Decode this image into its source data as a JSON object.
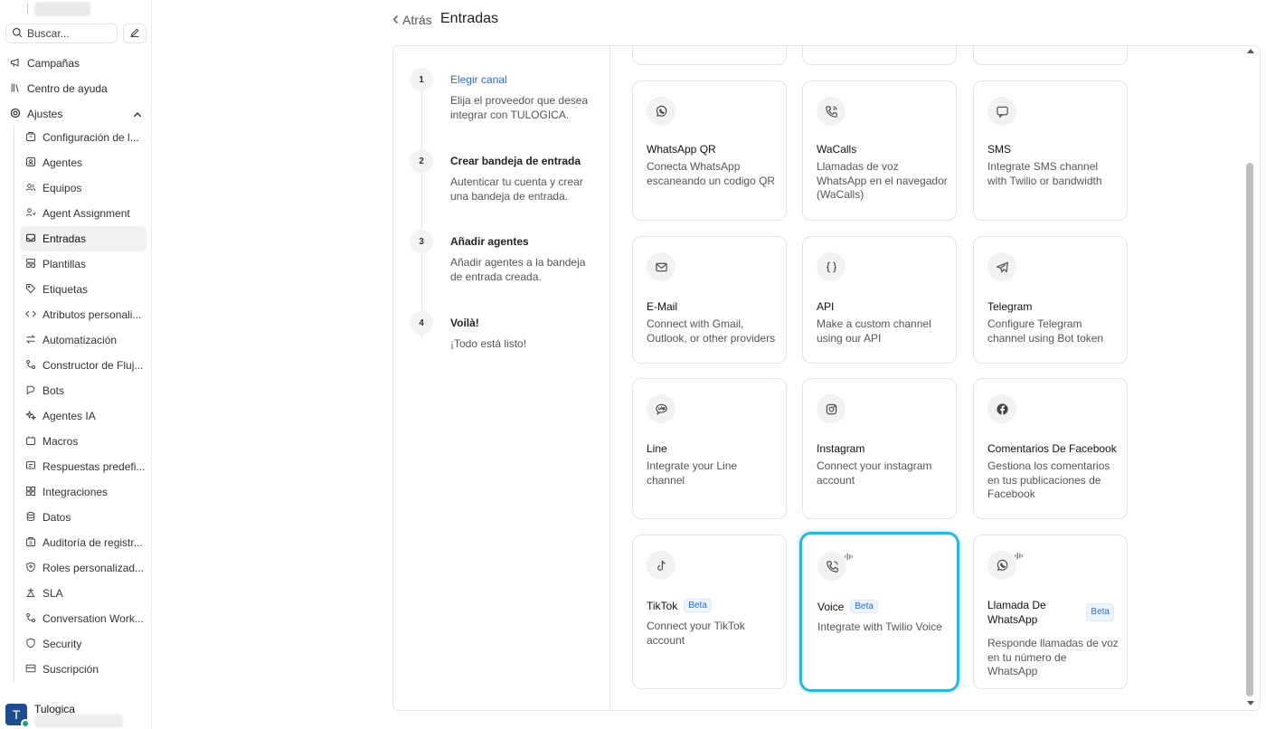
{
  "sidebar": {
    "search_placeholder": "Buscar...",
    "top_items": [
      {
        "label": "Campañas",
        "icon": "megaphone-icon"
      },
      {
        "label": "Centro de ayuda",
        "icon": "library-icon"
      },
      {
        "label": "Ajustes",
        "icon": "settings-icon"
      }
    ],
    "sub_items": [
      {
        "label": "Configuración de l...",
        "icon": "building-icon"
      },
      {
        "label": "Agentes",
        "icon": "agent-icon"
      },
      {
        "label": "Equipos",
        "icon": "team-icon"
      },
      {
        "label": "Agent Assignment",
        "icon": "assignment-icon"
      },
      {
        "label": "Entradas",
        "icon": "inbox-icon"
      },
      {
        "label": "Plantillas",
        "icon": "template-icon"
      },
      {
        "label": "Etiquetas",
        "icon": "tag-icon"
      },
      {
        "label": "Atributos personali...",
        "icon": "code-icon"
      },
      {
        "label": "Automatización",
        "icon": "automation-icon"
      },
      {
        "label": "Constructor de Fluj...",
        "icon": "flow-icon"
      },
      {
        "label": "Bots",
        "icon": "bot-icon"
      },
      {
        "label": "Agentes IA",
        "icon": "sparkles-icon"
      },
      {
        "label": "Macros",
        "icon": "macro-icon"
      },
      {
        "label": "Respuestas predefi...",
        "icon": "canned-response-icon"
      },
      {
        "label": "Integraciones",
        "icon": "integrations-icon"
      },
      {
        "label": "Datos",
        "icon": "database-icon"
      },
      {
        "label": "Auditoría de registr...",
        "icon": "audit-icon"
      },
      {
        "label": "Roles personalizad...",
        "icon": "shield-user-icon"
      },
      {
        "label": "SLA",
        "icon": "sla-icon"
      },
      {
        "label": "Conversation Work...",
        "icon": "workflow-icon"
      },
      {
        "label": "Security",
        "icon": "shield-icon"
      },
      {
        "label": "Suscripción",
        "icon": "card-icon"
      }
    ],
    "user": {
      "initial": "T",
      "name": "Tulogica"
    }
  },
  "header": {
    "back_label": "Atrás",
    "title": "Entradas"
  },
  "steps": [
    {
      "num": "1",
      "title": "Elegir canal",
      "desc": "Elija el proveedor que desea integrar con TULOGICA."
    },
    {
      "num": "2",
      "title": "Crear bandeja de entrada",
      "desc": "Autenticar tu cuenta y crear una bandeja de entrada."
    },
    {
      "num": "3",
      "title": "Añadir agentes",
      "desc": "Añadir agentes a la bandeja de entrada creada."
    },
    {
      "num": "4",
      "title": "Voilà!",
      "desc": "¡Todo está listo!"
    }
  ],
  "channels": [
    {
      "title": "WhatsApp QR",
      "desc": "Conecta WhatsApp escaneando un codigo QR",
      "icon": "whatsapp-icon"
    },
    {
      "title": "WaCalls",
      "desc": "Llamadas de voz WhatsApp en el navegador (WaCalls)",
      "icon": "phone-call-icon"
    },
    {
      "title": "SMS",
      "desc": "Integrate SMS channel with Twilio or bandwidth",
      "icon": "sms-icon"
    },
    {
      "title": "E-Mail",
      "desc": "Connect with Gmail, Outlook, or other providers",
      "icon": "email-icon"
    },
    {
      "title": "API",
      "desc": "Make a custom channel using our API",
      "icon": "api-braces-icon"
    },
    {
      "title": "Telegram",
      "desc": "Configure Telegram channel using Bot token",
      "icon": "telegram-icon"
    },
    {
      "title": "Line",
      "desc": "Integrate your Line channel",
      "icon": "line-icon"
    },
    {
      "title": "Instagram",
      "desc": "Connect your instagram account",
      "icon": "instagram-icon"
    },
    {
      "title": "Comentarios De Facebook",
      "desc": "Gestiona los comentarios en tus publicaciones de Facebook",
      "icon": "facebook-icon"
    },
    {
      "title": "TikTok",
      "badge": "Beta",
      "desc": "Connect your TikTok account",
      "icon": "tiktok-icon"
    },
    {
      "title": "Voice",
      "badge": "Beta",
      "desc": "Integrate with Twilio Voice",
      "icon": "voice-phone-icon"
    },
    {
      "title": "Llamada De WhatsApp",
      "badge": "Beta",
      "desc": "Responde llamadas de voz en tu número de WhatsApp",
      "icon": "whatsapp-call-icon"
    }
  ],
  "colors": {
    "accent": "#2a6ad6",
    "selected_ring": "#2ab6dc",
    "avatar": "#1b4d8f",
    "online": "#1aa36f"
  }
}
